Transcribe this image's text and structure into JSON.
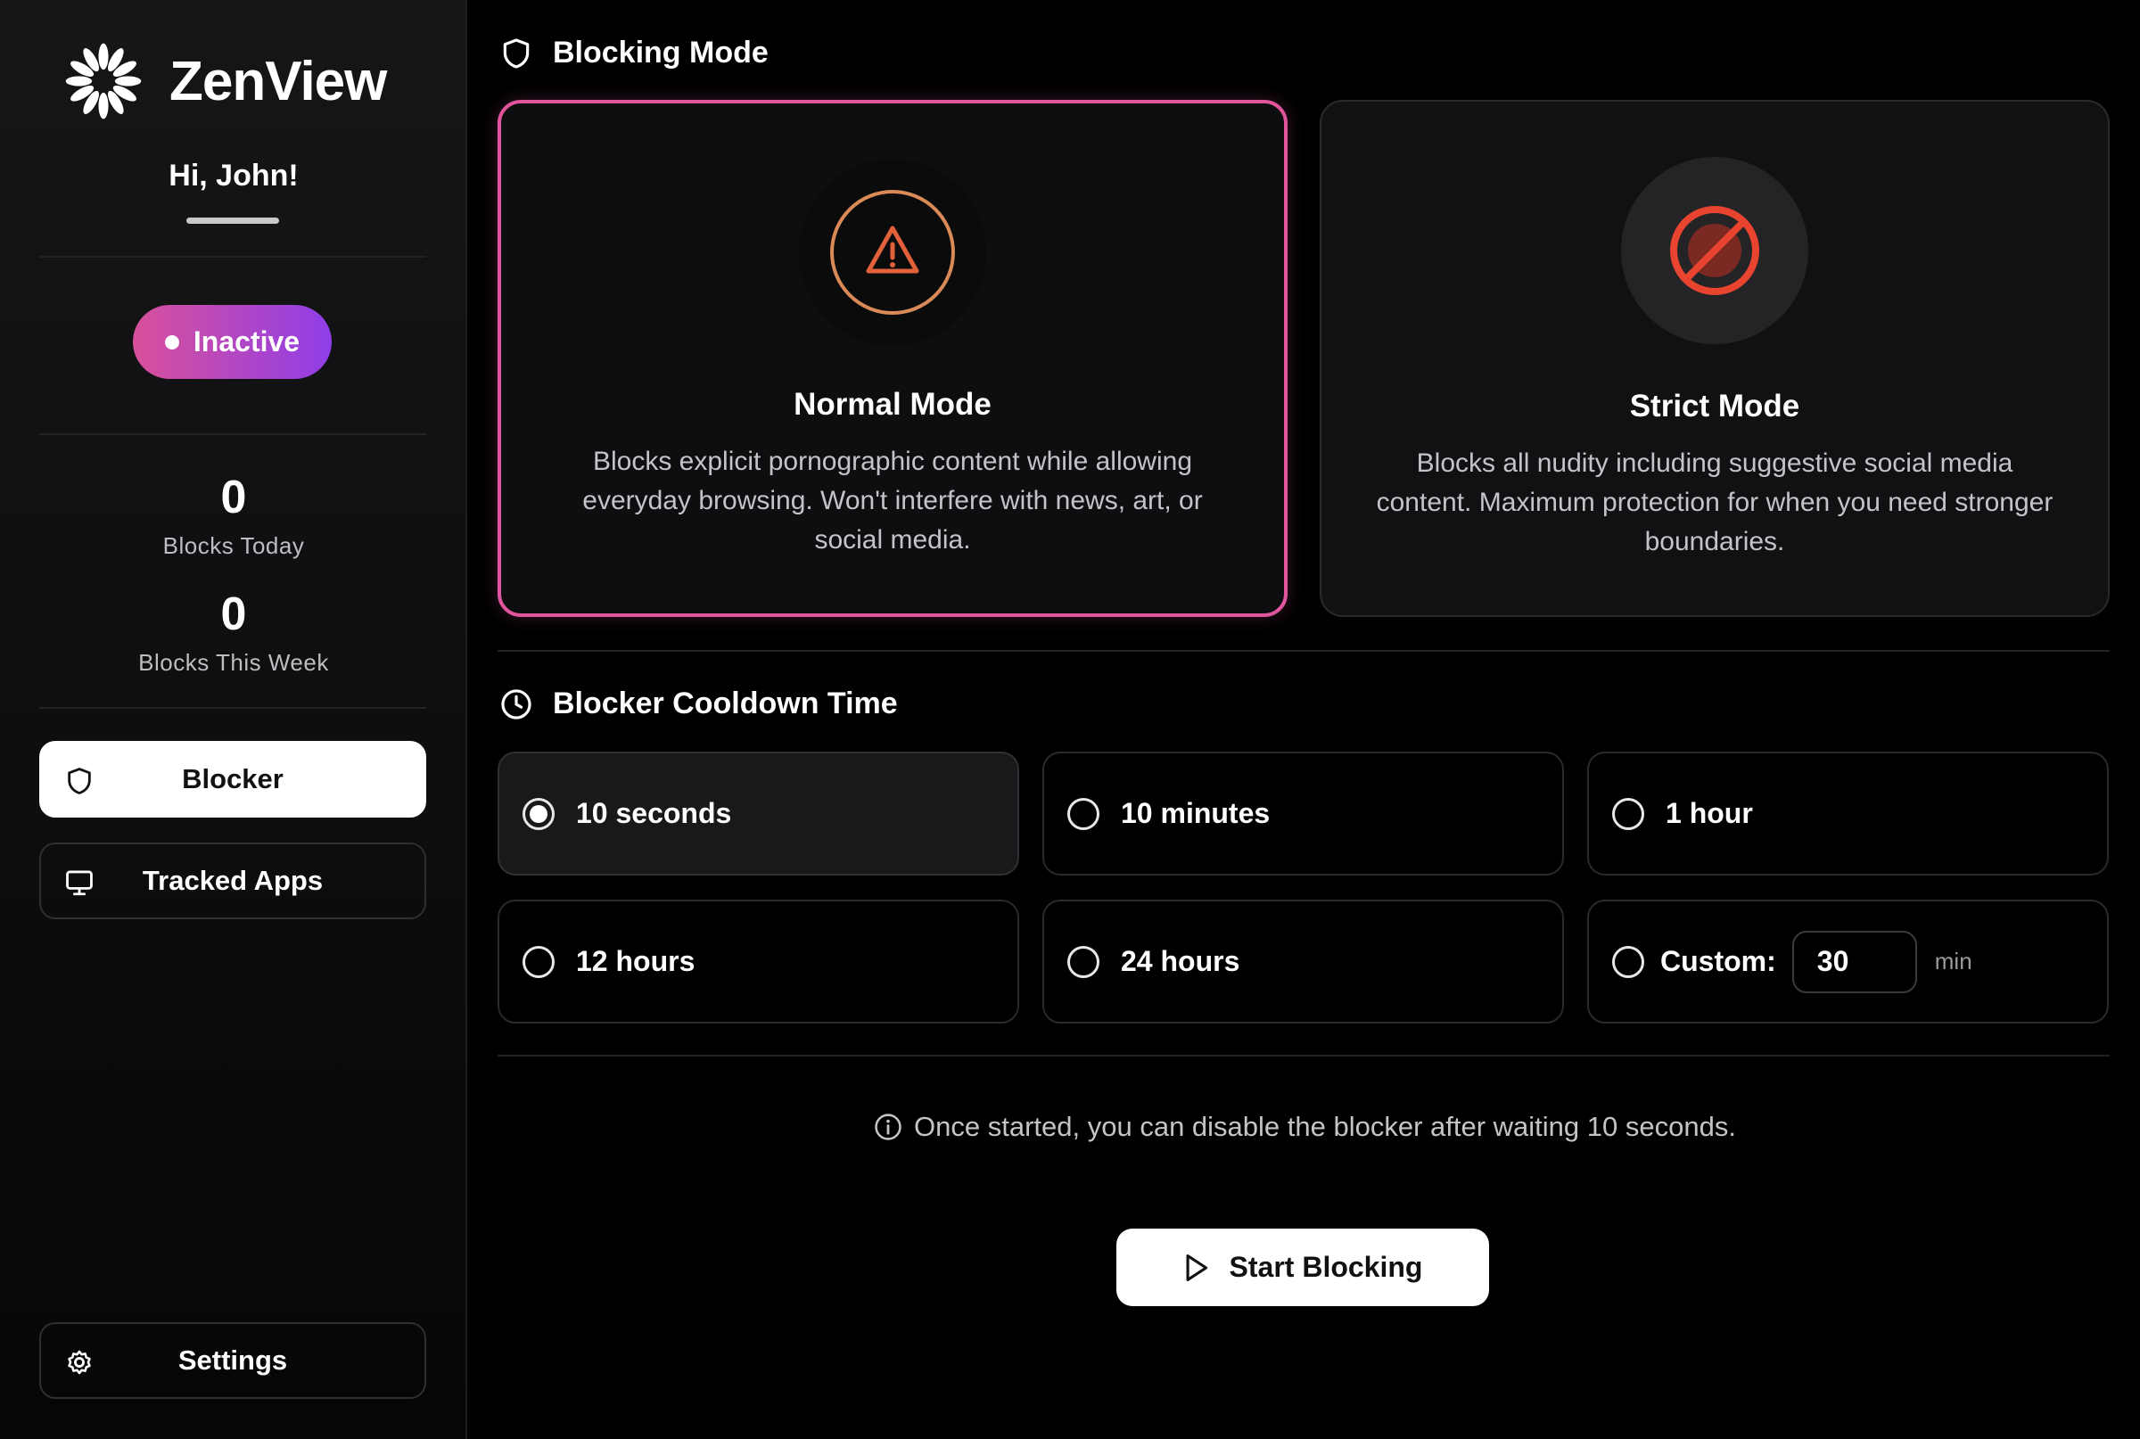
{
  "app": {
    "name": "ZenView"
  },
  "sidebar": {
    "greeting": "Hi, John!",
    "status": {
      "label": "Inactive"
    },
    "stats": [
      {
        "value": "0",
        "label": "Blocks Today"
      },
      {
        "value": "0",
        "label": "Blocks This Week"
      }
    ],
    "nav": [
      {
        "label": "Blocker",
        "icon": "shield-icon",
        "active": true
      },
      {
        "label": "Tracked Apps",
        "icon": "monitor-icon",
        "active": false
      }
    ],
    "settings": {
      "label": "Settings",
      "icon": "gear-icon"
    }
  },
  "blocking_mode": {
    "title": "Blocking Mode",
    "modes": [
      {
        "title": "Normal Mode",
        "description": "Blocks explicit pornographic content while allowing everyday browsing. Won't interfere with news, art, or social media.",
        "icon": "warning-triangle-icon",
        "selected": true
      },
      {
        "title": "Strict Mode",
        "description": "Blocks all nudity including suggestive social media content. Maximum protection for when you need stronger boundaries.",
        "icon": "prohibited-icon",
        "selected": false
      }
    ]
  },
  "cooldown": {
    "title": "Blocker Cooldown Time",
    "options": [
      {
        "label": "10 seconds",
        "selected": true
      },
      {
        "label": "10 minutes",
        "selected": false
      },
      {
        "label": "1 hour",
        "selected": false
      },
      {
        "label": "12 hours",
        "selected": false
      },
      {
        "label": "24 hours",
        "selected": false
      }
    ],
    "custom": {
      "label": "Custom:",
      "value": "30",
      "unit": "min",
      "selected": false
    }
  },
  "info_text": "Once started, you can disable the blocker after waiting 10 seconds.",
  "start_button": {
    "label": "Start Blocking"
  },
  "colors": {
    "accent_pink": "#e0559e",
    "accent_purple": "#8f3ee8",
    "warning_orange": "#e2603a",
    "prohibited_red": "#e8442f"
  }
}
